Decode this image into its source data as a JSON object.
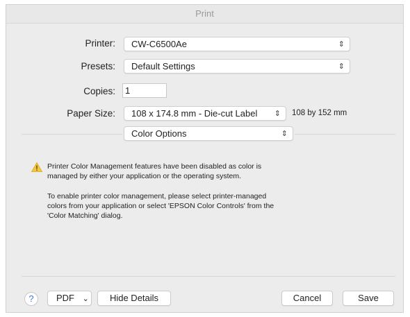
{
  "window": {
    "title": "Print"
  },
  "printer": {
    "label": "Printer:",
    "value": "CW-C6500Ae"
  },
  "presets": {
    "label": "Presets:",
    "value": "Default Settings"
  },
  "copies": {
    "label": "Copies:",
    "value": "1"
  },
  "paper_size": {
    "label": "Paper Size:",
    "value": "108 x 174.8 mm - Die-cut Label",
    "dimensions_note": "108 by 152 mm"
  },
  "section_popup": {
    "value": "Color Options"
  },
  "message": {
    "warning": "Printer Color Management features have been disabled as color is managed by either your application or the operating system.",
    "warning_line1": "Printer Color Management features have been disabled as color is",
    "warning_line2": "managed by either your application or the operating system.",
    "info_line1": "To enable printer color management, please select printer-managed",
    "info_line2": "colors from your application or select 'EPSON Color Controls' from the",
    "info_line3": "'Color Matching' dialog."
  },
  "icons": {
    "popup_arrows": "⌃⌄",
    "warning": "warning-triangle-icon",
    "help": "?"
  },
  "footer": {
    "help_label": "?",
    "pdf_label": "PDF",
    "pdf_chevron": "⌄",
    "hide_details_label": "Hide Details",
    "cancel_label": "Cancel",
    "save_label": "Save"
  },
  "colors": {
    "warning_fill": "#f4c542",
    "help_blue": "#3a7bd5"
  }
}
